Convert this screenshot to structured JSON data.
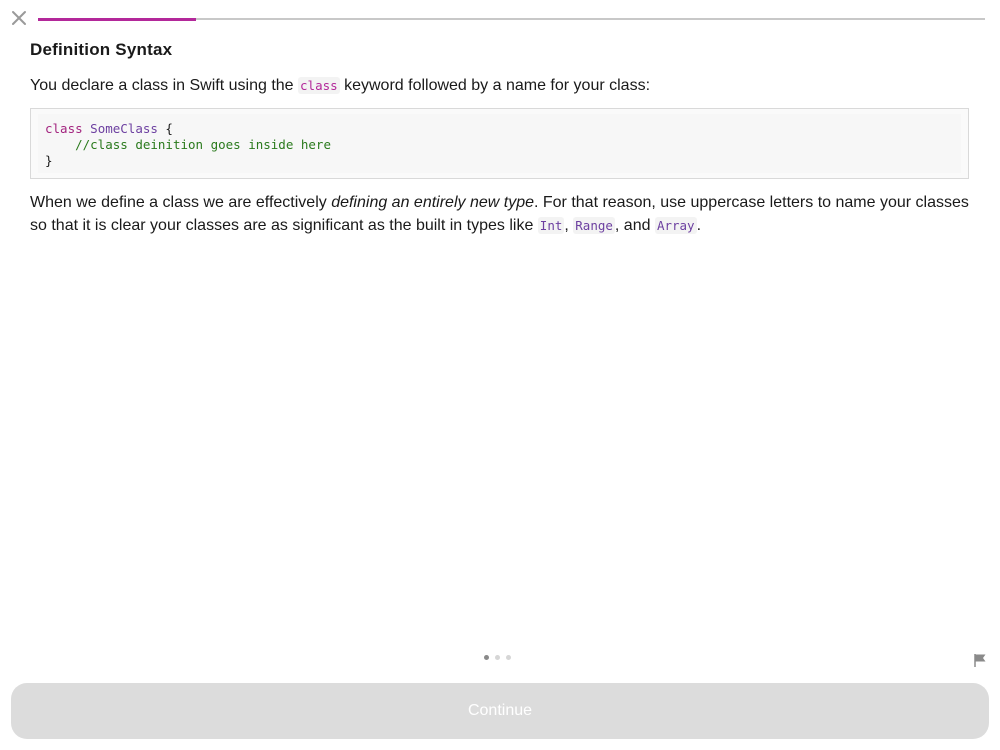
{
  "header": {
    "close_icon": "close-icon",
    "progress": 0.167,
    "progress_color": "#b3289a",
    "track_color": "#c8c8c8"
  },
  "lesson": {
    "title": "Definition Syntax",
    "paragraph1": {
      "before": "You declare a class in Swift using the ",
      "code": "class",
      "after": " keyword followed by a name for your class:"
    },
    "code_block": {
      "line1_keyword": "class",
      "line1_type": "SomeClass",
      "line1_rest": " {",
      "line2_indent": "    ",
      "line2_comment": "//class deinition goes inside here",
      "line3": "}"
    },
    "paragraph2": {
      "before": "When we define a class we are effectively ",
      "emphasis": "defining an entirely new type",
      "middle": ". For that reason, use uppercase letters to name your classes so that it is clear your classes are as significant as the built in types like ",
      "code1": "Int",
      "sep1": ", ",
      "code2": "Range",
      "sep2": ", and ",
      "code3": "Array",
      "end": "."
    }
  },
  "footer": {
    "page_count": 3,
    "current_page": 1,
    "flag_icon": "flag-icon",
    "continue_label": "Continue",
    "continue_bg": "#dcdcdc"
  }
}
